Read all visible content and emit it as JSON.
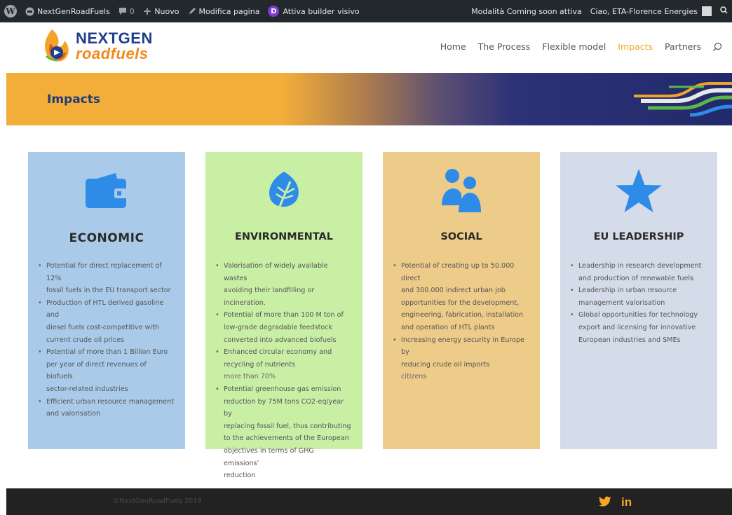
{
  "admin_bar": {
    "site_name": "NextGenRoadFuels",
    "comments_count": "0",
    "new_label": "Nuovo",
    "edit_page_label": "Modifica pagina",
    "builder_label": "Attiva builder visivo",
    "coming_soon_label": "Modalità Coming soon attiva",
    "greeting": "Ciao, ETA-Florence Energies"
  },
  "logo": {
    "line1": "NEXTGEN",
    "line2": "roadfuels"
  },
  "nav": {
    "items": [
      {
        "label": "Home"
      },
      {
        "label": "The Process"
      },
      {
        "label": "Flexible model"
      },
      {
        "label": "Impacts"
      },
      {
        "label": "Partners"
      }
    ],
    "active": "Impacts"
  },
  "banner": {
    "title": "Impacts"
  },
  "cards": [
    {
      "title": "ECONOMIC",
      "icon": "wallet-icon",
      "color": "#a9cbe9",
      "items": [
        "Potential for direct replacement of 12%",
        "fossil fuels in the EU transport sector",
        "Production of HTL derived gasoline and",
        "diesel fuels cost-competitive with",
        "current crude oil prices",
        "Potential of more than 1 Billion Euro",
        "per year of direct revenues of biofuels",
        "sector-related industries",
        "Efficient urban resource management",
        "and valorisation"
      ]
    },
    {
      "title": "ENVIRONMENTAL",
      "icon": "leaf-icon",
      "color": "#c9efa5",
      "items": [
        "Valorisation of widely available wastes",
        "avoiding their landfilling or incineration.",
        "Potential of more than 100 M ton of",
        "low-grade degradable feedstock",
        "converted into advanced biofuels",
        "Enhanced circular economy and",
        "recycling of nutrients",
        "more than 70%",
        "Potential greenhouse gas emission",
        "reduction by 75M tons CO2-eq/year by",
        "replacing fossil fuel, thus contributing",
        "to the achievements of the European",
        "objectives in terms of GHG emissions’",
        "reduction"
      ]
    },
    {
      "title": "SOCIAL",
      "icon": "users-icon",
      "color": "#edcb88",
      "items": [
        "Potential of creating up to 50.000 direct",
        "and 300.000 indirect urban job",
        "opportunities for the development,",
        "engineering, fabrication, installation",
        "and operation of HTL plants",
        "Increasing energy security in Europe by",
        "reducing crude oil imports",
        "citizens"
      ]
    },
    {
      "title": "EU LEADERSHIP",
      "icon": "star-icon",
      "color": "#d3dce8",
      "items": [
        "Leadership in research development",
        "and production of renewable fuels",
        "Leadership in urban resource",
        "management valorisation",
        "Global opportunities for technology",
        "export and licensing for innovative",
        "European industries and SMEs"
      ]
    }
  ],
  "footer": {
    "copyright": "©NextGenRoadFuels 2019",
    "social": [
      "twitter-icon",
      "linkedin-icon"
    ],
    "linkedin_text": "in"
  },
  "colors": {
    "accent": "#f5a623",
    "brand_blue": "#213a7d",
    "icon_blue": "#2f8be8"
  }
}
